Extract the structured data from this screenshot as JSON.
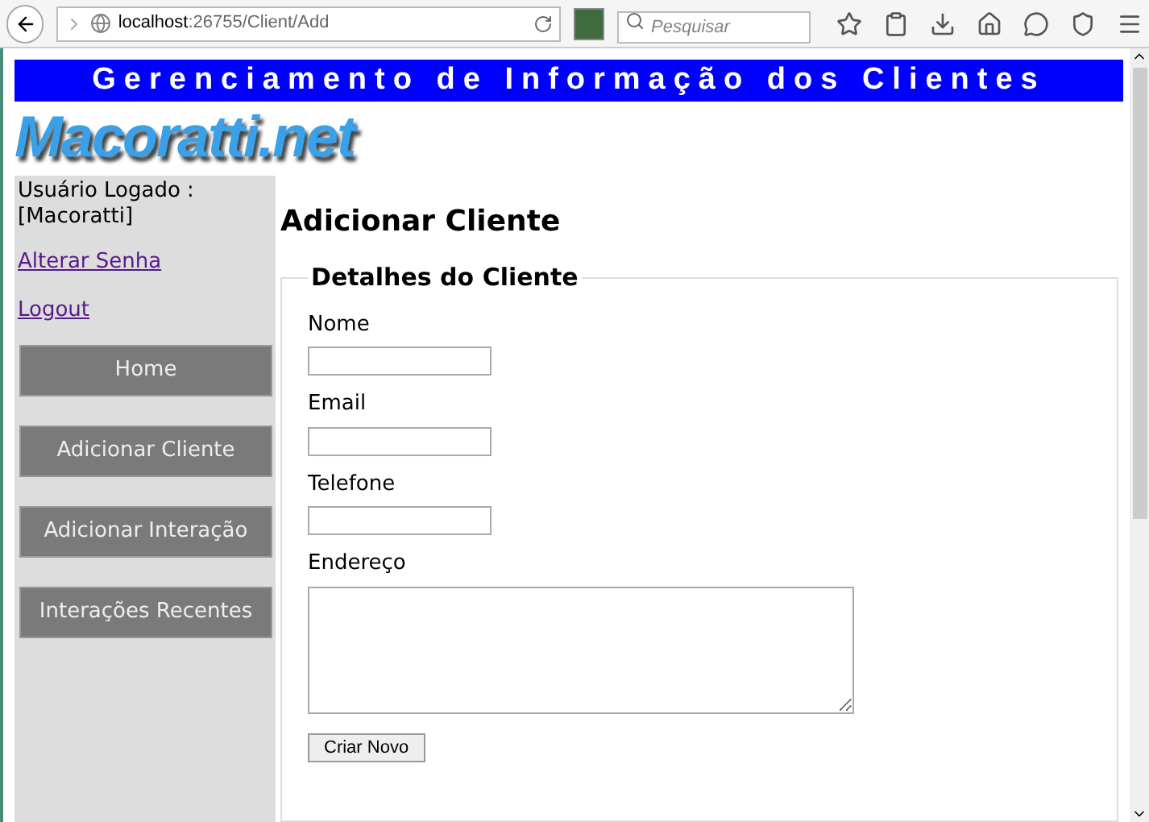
{
  "browser": {
    "url_host": "localhost",
    "url_path": ":26755/Client/Add",
    "search_placeholder": "Pesquisar"
  },
  "banner": {
    "title": "Gerenciamento de Informação dos Clientes"
  },
  "logo": {
    "text": "Macoratti.net"
  },
  "sidebar": {
    "user_label": "Usuário Logado :",
    "user_name": "[Macoratti]",
    "links": [
      "Alterar Senha",
      "Logout"
    ],
    "nav": [
      "Home",
      "Adicionar Cliente",
      "Adicionar Interação",
      "Interações Recentes"
    ]
  },
  "main": {
    "heading": "Adicionar Cliente",
    "legend": "Detalhes do Cliente",
    "fields": [
      {
        "label": "Nome",
        "kind": "input"
      },
      {
        "label": "Email",
        "kind": "input"
      },
      {
        "label": "Telefone",
        "kind": "input"
      },
      {
        "label": "Endereço",
        "kind": "textarea"
      }
    ],
    "submit": "Criar Novo"
  }
}
